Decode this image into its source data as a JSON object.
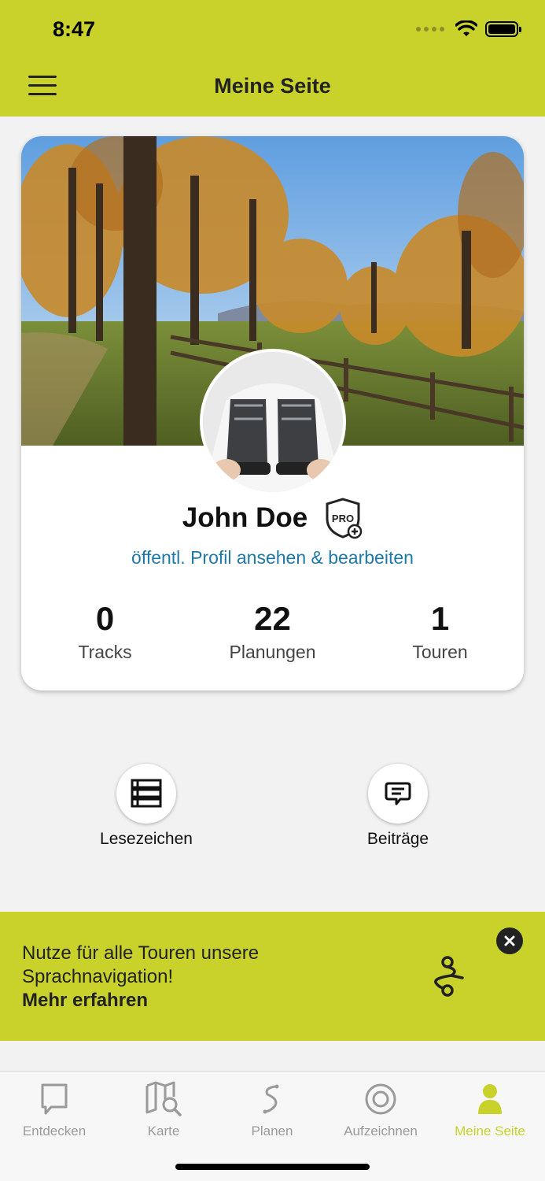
{
  "status_bar": {
    "time": "8:47"
  },
  "header": {
    "title": "Meine Seite"
  },
  "profile": {
    "name": "John Doe",
    "badge": "PRO",
    "link_text": "öffentl. Profil ansehen & bearbeiten",
    "stats": [
      {
        "value": "0",
        "label": "Tracks"
      },
      {
        "value": "22",
        "label": "Planungen"
      },
      {
        "value": "1",
        "label": "Touren"
      }
    ]
  },
  "actions": [
    {
      "label": "Lesezeichen",
      "icon": "bookmarks-icon"
    },
    {
      "label": "Beiträge",
      "icon": "comment-icon"
    }
  ],
  "banner": {
    "line1": "Nutze für alle Touren unsere",
    "line2": "Sprachnavigation!",
    "more": "Mehr erfahren"
  },
  "tabs": [
    {
      "label": "Entdecken",
      "icon": "discover-icon"
    },
    {
      "label": "Karte",
      "icon": "map-search-icon"
    },
    {
      "label": "Planen",
      "icon": "route-plan-icon"
    },
    {
      "label": "Aufzeichnen",
      "icon": "record-icon"
    },
    {
      "label": "Meine Seite",
      "icon": "user-icon",
      "active": true
    }
  ],
  "colors": {
    "accent": "#c8d22a",
    "link": "#1e79a8",
    "inactive": "#9a9a9a"
  }
}
